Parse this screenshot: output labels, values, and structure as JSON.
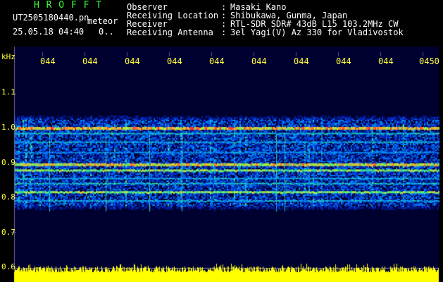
{
  "header": {
    "app_title": "H R O F F T",
    "file_name": "UT2505180440.pn",
    "meteor_label": "meteor",
    "datetime": "25.05.18 04:40",
    "count": "0..",
    "metadata": [
      {
        "label": "Observer",
        "value": "Masaki Kano"
      },
      {
        "label": "Receiving Location",
        "value": "Shibukawa, Gunma, Japan"
      },
      {
        "label": "Receiver",
        "value": "RTL-SDR SDR# 43dB L15 103.2MHz CW"
      },
      {
        "label": "Receiving Antenna",
        "value": "3el Yagi(V) Az 330 for Vladivostok"
      }
    ],
    "separator": ":"
  },
  "spectrogram": {
    "y_unit": "kHz",
    "y_ticks": [
      "1.1",
      "1.0",
      "0.9",
      "0.8",
      "0.7",
      "0.6"
    ],
    "time_ticks": [
      "044",
      "044",
      "044",
      "044",
      "044",
      "044",
      "044",
      "044",
      "044",
      "0450"
    ],
    "colors": {
      "tick": "#ffff40",
      "title": "#3cff3c",
      "background": "#000030",
      "noise_bar": "#ffff00"
    }
  }
}
